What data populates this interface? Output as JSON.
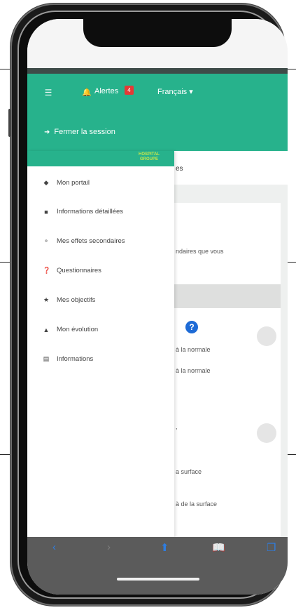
{
  "nav": {
    "menu_icon": "hamburger-icon",
    "alerts_icon": "bell-icon",
    "alerts_label": "Alertes",
    "alerts_count": "4",
    "language_label": "Français ▾"
  },
  "session": {
    "logout_icon": "logout-icon",
    "logout_label": "Fermer la session"
  },
  "drawer": {
    "logo_text": "HOSPITAL GROUPE",
    "items": [
      {
        "icon": "gem-icon",
        "label": "Mon portail"
      },
      {
        "icon": "graduation-cap-icon",
        "label": "Informations détaillées"
      },
      {
        "icon": "stethoscope-icon",
        "label": "Mes effets secondaires"
      },
      {
        "icon": "question-circle-icon",
        "label": "Questionnaires"
      },
      {
        "icon": "star-icon",
        "label": "Mes objectifs"
      },
      {
        "icon": "chart-area-icon",
        "label": "Mon évolution"
      },
      {
        "icon": "list-icon",
        "label": "Informations"
      }
    ]
  },
  "background": {
    "heading_tail": "es",
    "sentence_tail": "ndaires que vous",
    "option1": "à la normale",
    "option2": "à la normale",
    "option3": "a surface",
    "option4": "à de la surface"
  },
  "toolbar": {
    "back_icon": "back-icon",
    "forward_icon": "forward-icon",
    "share_icon": "share-icon",
    "bookmarks_icon": "book-icon",
    "tabs_icon": "tabs-icon"
  },
  "colors": {
    "primary": "#27b28c",
    "badge": "#e53935",
    "toolbar": "#5b5b5b",
    "link": "#2f7de0"
  }
}
